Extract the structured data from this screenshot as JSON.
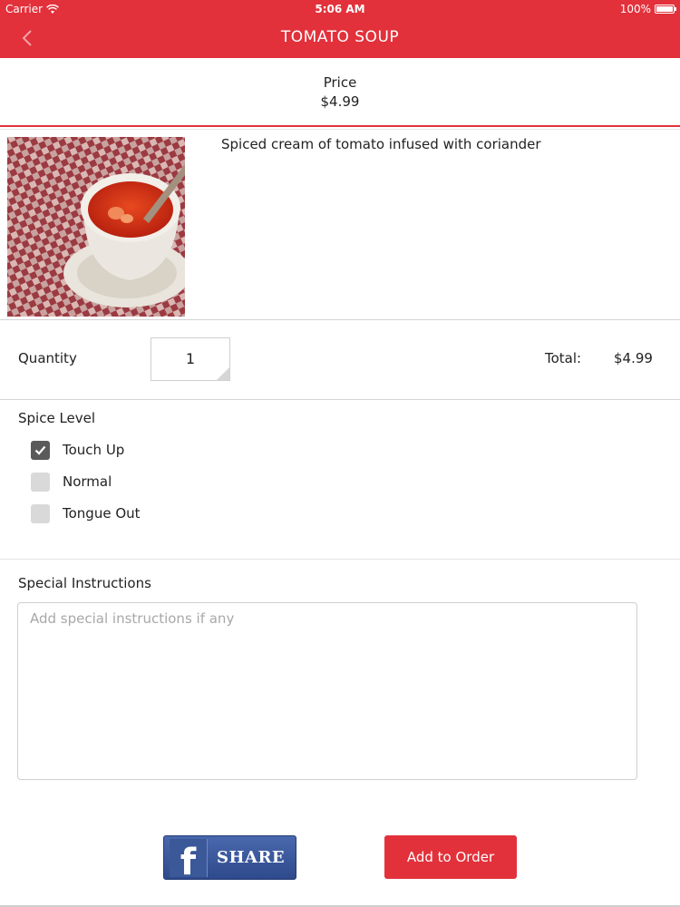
{
  "status_bar": {
    "carrier": "Carrier",
    "time": "5:06 AM",
    "battery": "100%"
  },
  "nav": {
    "title": "TOMATO SOUP",
    "back_icon": "chevron-left-icon"
  },
  "price": {
    "label": "Price",
    "value": "$4.99"
  },
  "dish": {
    "image": "tomato-soup-photo",
    "description": "Spiced cream of tomato infused with coriander"
  },
  "quantity": {
    "label": "Quantity",
    "value": "1",
    "total_label": "Total:",
    "total_value": "$4.99"
  },
  "spice": {
    "title": "Spice Level",
    "options": [
      {
        "label": "Touch Up",
        "checked": true
      },
      {
        "label": "Normal",
        "checked": false
      },
      {
        "label": "Tongue Out",
        "checked": false
      }
    ]
  },
  "instructions": {
    "title": "Special Instructions",
    "placeholder": "Add special instructions if any",
    "value": ""
  },
  "actions": {
    "share_label": "SHARE",
    "share_icon": "facebook-icon",
    "add_label": "Add to Order"
  },
  "colors": {
    "accent": "#e2313b",
    "facebook": "#3b5998"
  }
}
